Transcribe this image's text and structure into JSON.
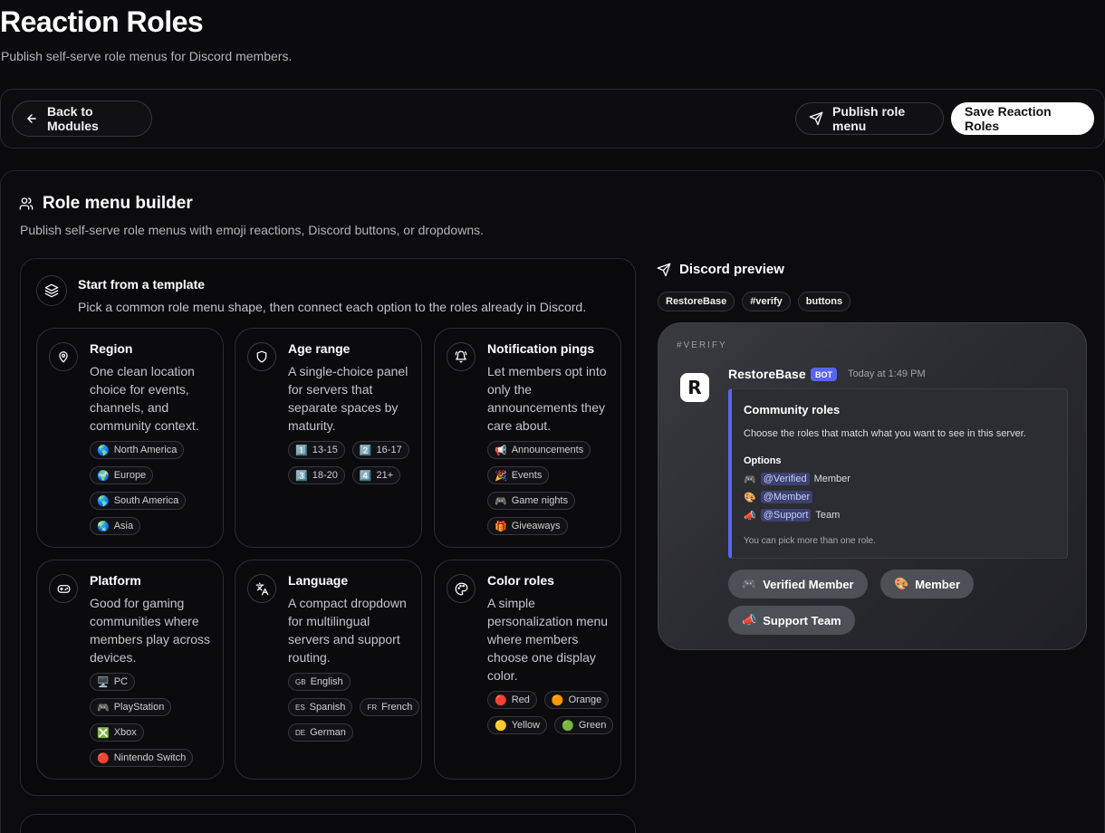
{
  "header": {
    "title": "Reaction Roles",
    "subtitle": "Publish self-serve role menus for Discord members."
  },
  "toolbar": {
    "back_label": "Back to Modules",
    "publish_label": "Publish role menu",
    "save_label": "Save Reaction Roles"
  },
  "builder": {
    "title": "Role menu builder",
    "description": "Publish self-serve role menus with emoji reactions, Discord buttons, or dropdowns."
  },
  "templates": {
    "title": "Start from a template",
    "description": "Pick a common role menu shape, then connect each option to the roles already in Discord.",
    "cards": [
      {
        "icon": "map-pin-icon",
        "title": "Region",
        "description": "One clean location choice for events, channels, and community context.",
        "chips": [
          {
            "emoji": "🌎",
            "label": "North America"
          },
          {
            "emoji": "🌍",
            "label": "Europe"
          },
          {
            "emoji": "🌎",
            "label": "South America"
          },
          {
            "emoji": "🌏",
            "label": "Asia"
          }
        ]
      },
      {
        "icon": "shield-icon",
        "title": "Age range",
        "description": "A single-choice panel for servers that separate spaces by maturity.",
        "chips": [
          {
            "emoji": "1️⃣",
            "label": "13-15"
          },
          {
            "emoji": "2️⃣",
            "label": "16-17"
          },
          {
            "emoji": "3️⃣",
            "label": "18-20"
          },
          {
            "emoji": "4️⃣",
            "label": "21+"
          }
        ]
      },
      {
        "icon": "bell-ring-icon",
        "title": "Notification pings",
        "description": "Let members opt into only the announcements they care about.",
        "chips": [
          {
            "emoji": "📢",
            "label": "Announcements"
          },
          {
            "emoji": "🎉",
            "label": "Events"
          },
          {
            "emoji": "🎮",
            "label": "Game nights"
          },
          {
            "emoji": "🎁",
            "label": "Giveaways"
          }
        ]
      },
      {
        "icon": "gamepad-icon",
        "title": "Platform",
        "description": "Good for gaming communities where members play across devices.",
        "chips": [
          {
            "emoji": "🖥️",
            "label": "PC"
          },
          {
            "emoji": "🎮",
            "label": "PlayStation"
          },
          {
            "emoji": "❎",
            "label": "Xbox"
          },
          {
            "emoji": "🔴",
            "label": "Nintendo Switch"
          }
        ]
      },
      {
        "icon": "translate-icon",
        "title": "Language",
        "description": "A compact dropdown for multilingual servers and support routing.",
        "chips": [
          {
            "emoji": "GB",
            "label": "English"
          },
          {
            "emoji": "ES",
            "label": "Spanish"
          },
          {
            "emoji": "FR",
            "label": "French"
          },
          {
            "emoji": "DE",
            "label": "German"
          }
        ]
      },
      {
        "icon": "palette-icon",
        "title": "Color roles",
        "description": "A simple personalization menu where members choose one display color.",
        "chips": [
          {
            "emoji": "🔴",
            "label": "Red"
          },
          {
            "emoji": "🟠",
            "label": "Orange"
          },
          {
            "emoji": "🟡",
            "label": "Yellow"
          },
          {
            "emoji": "🟢",
            "label": "Green"
          }
        ]
      }
    ]
  },
  "preview": {
    "title": "Discord preview",
    "tags": [
      "RestoreBase",
      "#verify",
      "buttons"
    ],
    "channel": "#VERIFY",
    "bot_name": "RestoreBase",
    "bot_badge": "BOT",
    "time": "Today at 1:49 PM",
    "embed": {
      "title": "Community roles",
      "description": "Choose the roles that match what you want to see in this server.",
      "options_heading": "Options",
      "options": [
        {
          "emoji": "🎮",
          "mention": "@Verified",
          "suffix": "Member"
        },
        {
          "emoji": "🎨",
          "mention": "@Member",
          "suffix": ""
        },
        {
          "emoji": "📣",
          "mention": "@Support",
          "suffix": "Team"
        }
      ],
      "footer": "You can pick more than one role."
    },
    "buttons": [
      {
        "emoji": "🎮",
        "label": "Verified Member"
      },
      {
        "emoji": "🎨",
        "label": "Member"
      },
      {
        "emoji": "📣",
        "label": "Support Team"
      }
    ]
  },
  "colors": {
    "background": "#0b0b0d",
    "blurple": "#5865f2",
    "save_button": "#ffffff"
  }
}
